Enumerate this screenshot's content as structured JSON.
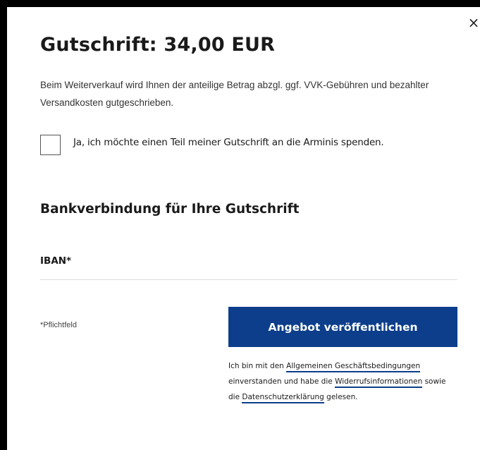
{
  "modal": {
    "close_symbol": "×",
    "title": "Gutschrift: 34,00 EUR",
    "description": "Beim Weiterverkauf wird Ihnen der anteilige Betrag abzgl. ggf. VVK-Gebühren und bezahlter Versandkosten gutgeschrieben.",
    "donation_checkbox": {
      "label": "Ja, ich möchte einen Teil meiner Gutschrift an die Arminis spenden.",
      "checked": false
    },
    "bank_section": {
      "heading": "Bankverbindung für Ihre Gutschrift",
      "iban_label": "IBAN*",
      "iban_value": ""
    },
    "required_note": "*Pflichtfeld",
    "submit_label": "Angebot veröffentlichen",
    "terms": {
      "prefix": "Ich bin mit den ",
      "agb_link": "Allgemeinen Geschäftsbedingungen",
      "middle": " einverstanden und habe die ",
      "widerruf_link": "Widerrufsinformationen",
      "connector": " sowie die ",
      "privacy_link": "Datenschutzerklärung",
      "suffix": " gelesen."
    }
  },
  "colors": {
    "backdrop": "#000000",
    "primary_button": "#0c3e8b",
    "link_underline": "#0c3e8b"
  }
}
